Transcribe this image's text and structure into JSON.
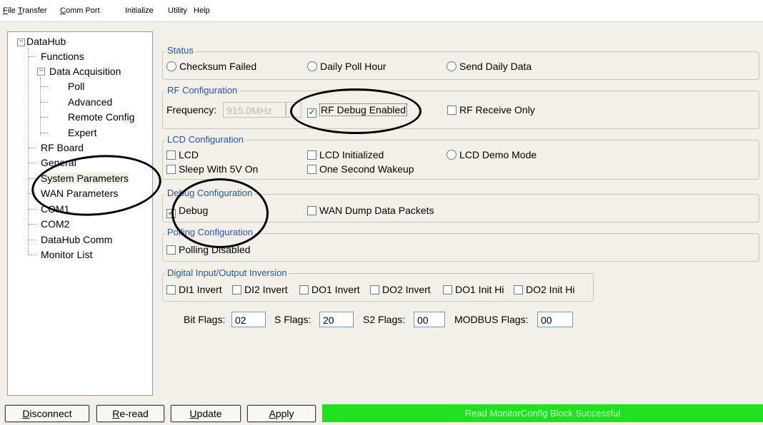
{
  "menu": [
    {
      "mnemonic": "F",
      "rest": "ile"
    },
    {
      "mnemonic": "T",
      "rest": "ransfer"
    },
    {
      "mnemonic": "C",
      "rest": "omm Port"
    },
    {
      "mnemonic": "",
      "rest": "Initialize"
    },
    {
      "mnemonic": "",
      "rest": "Utility"
    },
    {
      "mnemonic": "",
      "rest": "Help"
    }
  ],
  "tree": {
    "root": "DataHub",
    "functions": "Functions",
    "data_acquisition": "Data Acquisition",
    "poll": "Poll",
    "advanced": "Advanced",
    "remote_config": "Remote Config",
    "expert": "Expert",
    "rf_board": "RF Board",
    "general": "General",
    "system_parameters": "System Parameters",
    "wan_parameters": "WAN Parameters",
    "com1": "COM1",
    "com2": "COM2",
    "datahub_comm": "DataHub Comm",
    "monitor_list": "Monitor List",
    "expander_minus": "−"
  },
  "status_group": {
    "title": "Status",
    "checksum_failed": "Checksum Failed",
    "daily_poll_hour": "Daily Poll Hour",
    "send_daily_data": "Send Daily Data"
  },
  "rf_group": {
    "title": "RF Configuration",
    "frequency_label": "Frequency:",
    "frequency_value": "915.0MHz",
    "rf_debug_enabled": "RF Debug Enabled",
    "rf_debug_enabled_checked": true,
    "rf_receive_only": "RF Receive Only"
  },
  "lcd_group": {
    "title": "LCD Configuration",
    "lcd": "LCD",
    "lcd_initialized": "LCD Initialized",
    "lcd_demo_mode": "LCD Demo Mode",
    "sleep_with_5v_on": "Sleep With 5V On",
    "one_second_wakeup": "One Second Wakeup"
  },
  "debug_group": {
    "title": "Debug Configuration",
    "debug": "Debug",
    "debug_checked": true,
    "wan_dump": "WAN Dump Data Packets"
  },
  "polling_group": {
    "title": "Polling Configuration",
    "polling_disabled": "Polling Disabled"
  },
  "dio_group": {
    "title": "Digital Input/Output Inversion",
    "di1": "DI1 Invert",
    "di2": "DI2 Invert",
    "do1": "DO1 Invert",
    "do2": "DO2 Invert",
    "do1_init": "DO1 Init Hi",
    "do2_init": "DO2 Init Hi"
  },
  "flags": {
    "bit_label": "Bit Flags:",
    "bit_value": "02",
    "s_label": "S Flags:",
    "s_value": "20",
    "s2_label": "S2 Flags:",
    "s2_value": "00",
    "modbus_label": "MODBUS Flags:",
    "modbus_value": "00"
  },
  "buttons": {
    "disconnect": {
      "mnemonic": "D",
      "rest": "isconnect"
    },
    "reread": {
      "mnemonic": "R",
      "rest": "e-read"
    },
    "update": {
      "mnemonic": "U",
      "rest": "pdate"
    },
    "apply": {
      "mnemonic": "A",
      "rest": "pply"
    }
  },
  "status_bar": {
    "message": "Read MonitorConfig Block Successful",
    "color": "#1de21d"
  }
}
